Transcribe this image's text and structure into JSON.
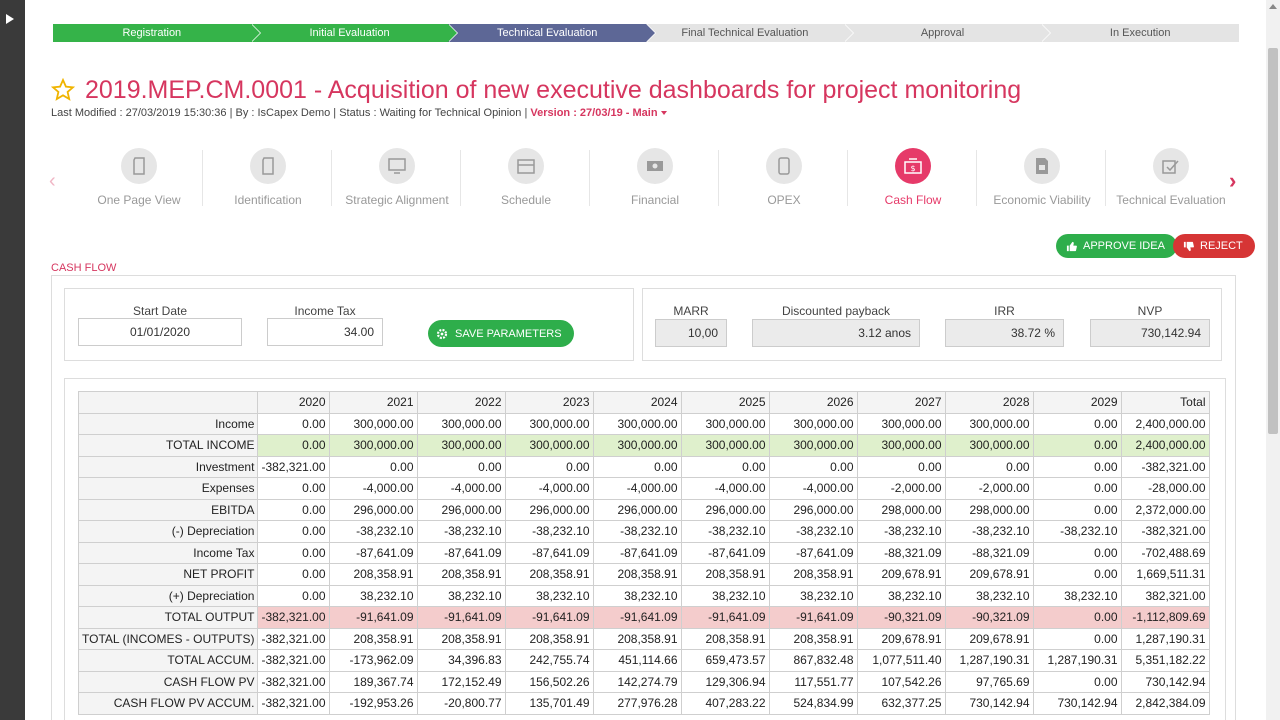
{
  "steps": [
    "Registration",
    "Initial Evaluation",
    "Technical Evaluation",
    "Final Technical Evaluation",
    "Approval",
    "In Execution"
  ],
  "title": "2019.MEP.CM.0001 - Acquisition of new executive dashboards for project monitoring",
  "meta": {
    "text": "Last Modified : 27/03/2019 15:30:36 | By : IsCapex Demo | Status : Waiting for Technical Opinion | ",
    "version": "Version : 27/03/19 - Main"
  },
  "tabs": [
    "One Page View",
    "Identification",
    "Strategic Alignment",
    "Schedule",
    "Financial",
    "OPEX",
    "Cash Flow",
    "Economic Viability",
    "Technical Evaluation"
  ],
  "actions": {
    "approve": "APPROVE IDEA",
    "reject": "REJECT"
  },
  "section_label": "CASH FLOW",
  "params": {
    "start_date_label": "Start Date",
    "start_date": "01/01/2020",
    "income_tax_label": "Income Tax",
    "income_tax": "34.00",
    "save_label": "SAVE PARAMETERS"
  },
  "results": {
    "marr_label": "MARR",
    "marr": "10,00",
    "payback_label": "Discounted payback",
    "payback": "3.12 anos",
    "irr_label": "IRR",
    "irr": "38.72 %",
    "nvp_label": "NVP",
    "nvp": "730,142.94"
  },
  "table": {
    "headers": [
      "2020",
      "2021",
      "2022",
      "2023",
      "2024",
      "2025",
      "2026",
      "2027",
      "2028",
      "2029",
      "Total"
    ],
    "rows": [
      {
        "label": "Income",
        "v": [
          "0.00",
          "300,000.00",
          "300,000.00",
          "300,000.00",
          "300,000.00",
          "300,000.00",
          "300,000.00",
          "300,000.00",
          "300,000.00",
          "0.00",
          "2,400,000.00"
        ]
      },
      {
        "label": "TOTAL INCOME",
        "v": [
          "0.00",
          "300,000.00",
          "300,000.00",
          "300,000.00",
          "300,000.00",
          "300,000.00",
          "300,000.00",
          "300,000.00",
          "300,000.00",
          "0.00",
          "2,400,000.00"
        ]
      },
      {
        "label": "Investment",
        "v": [
          "-382,321.00",
          "0.00",
          "0.00",
          "0.00",
          "0.00",
          "0.00",
          "0.00",
          "0.00",
          "0.00",
          "0.00",
          "-382,321.00"
        ]
      },
      {
        "label": "Expenses",
        "v": [
          "0.00",
          "-4,000.00",
          "-4,000.00",
          "-4,000.00",
          "-4,000.00",
          "-4,000.00",
          "-4,000.00",
          "-2,000.00",
          "-2,000.00",
          "0.00",
          "-28,000.00"
        ]
      },
      {
        "label": "EBITDA",
        "v": [
          "0.00",
          "296,000.00",
          "296,000.00",
          "296,000.00",
          "296,000.00",
          "296,000.00",
          "296,000.00",
          "298,000.00",
          "298,000.00",
          "0.00",
          "2,372,000.00"
        ]
      },
      {
        "label": "(-) Depreciation",
        "v": [
          "0.00",
          "-38,232.10",
          "-38,232.10",
          "-38,232.10",
          "-38,232.10",
          "-38,232.10",
          "-38,232.10",
          "-38,232.10",
          "-38,232.10",
          "-38,232.10",
          "-382,321.00"
        ]
      },
      {
        "label": "Income Tax",
        "v": [
          "0.00",
          "-87,641.09",
          "-87,641.09",
          "-87,641.09",
          "-87,641.09",
          "-87,641.09",
          "-87,641.09",
          "-88,321.09",
          "-88,321.09",
          "0.00",
          "-702,488.69"
        ]
      },
      {
        "label": "NET PROFIT",
        "v": [
          "0.00",
          "208,358.91",
          "208,358.91",
          "208,358.91",
          "208,358.91",
          "208,358.91",
          "208,358.91",
          "209,678.91",
          "209,678.91",
          "0.00",
          "1,669,511.31"
        ]
      },
      {
        "label": "(+) Depreciation",
        "v": [
          "0.00",
          "38,232.10",
          "38,232.10",
          "38,232.10",
          "38,232.10",
          "38,232.10",
          "38,232.10",
          "38,232.10",
          "38,232.10",
          "38,232.10",
          "382,321.00"
        ]
      },
      {
        "label": "TOTAL OUTPUT",
        "v": [
          "-382,321.00",
          "-91,641.09",
          "-91,641.09",
          "-91,641.09",
          "-91,641.09",
          "-91,641.09",
          "-91,641.09",
          "-90,321.09",
          "-90,321.09",
          "0.00",
          "-1,112,809.69"
        ]
      },
      {
        "label": "TOTAL (INCOMES - OUTPUTS)",
        "v": [
          "-382,321.00",
          "208,358.91",
          "208,358.91",
          "208,358.91",
          "208,358.91",
          "208,358.91",
          "208,358.91",
          "209,678.91",
          "209,678.91",
          "0.00",
          "1,287,190.31"
        ]
      },
      {
        "label": "TOTAL ACCUM.",
        "v": [
          "-382,321.00",
          "-173,962.09",
          "34,396.83",
          "242,755.74",
          "451,114.66",
          "659,473.57",
          "867,832.48",
          "1,077,511.40",
          "1,287,190.31",
          "1,287,190.31",
          "5,351,182.22"
        ]
      },
      {
        "label": "CASH FLOW PV",
        "v": [
          "-382,321.00",
          "189,367.74",
          "172,152.49",
          "156,502.26",
          "142,274.79",
          "129,306.94",
          "117,551.77",
          "107,542.26",
          "97,765.69",
          "0.00",
          "730,142.94"
        ]
      },
      {
        "label": "CASH FLOW PV ACCUM.",
        "v": [
          "-382,321.00",
          "-192,953.26",
          "-20,800.77",
          "135,701.49",
          "277,976.28",
          "407,283.22",
          "524,834.99",
          "632,377.25",
          "730,142.94",
          "730,142.94",
          "2,842,384.09"
        ]
      }
    ]
  }
}
